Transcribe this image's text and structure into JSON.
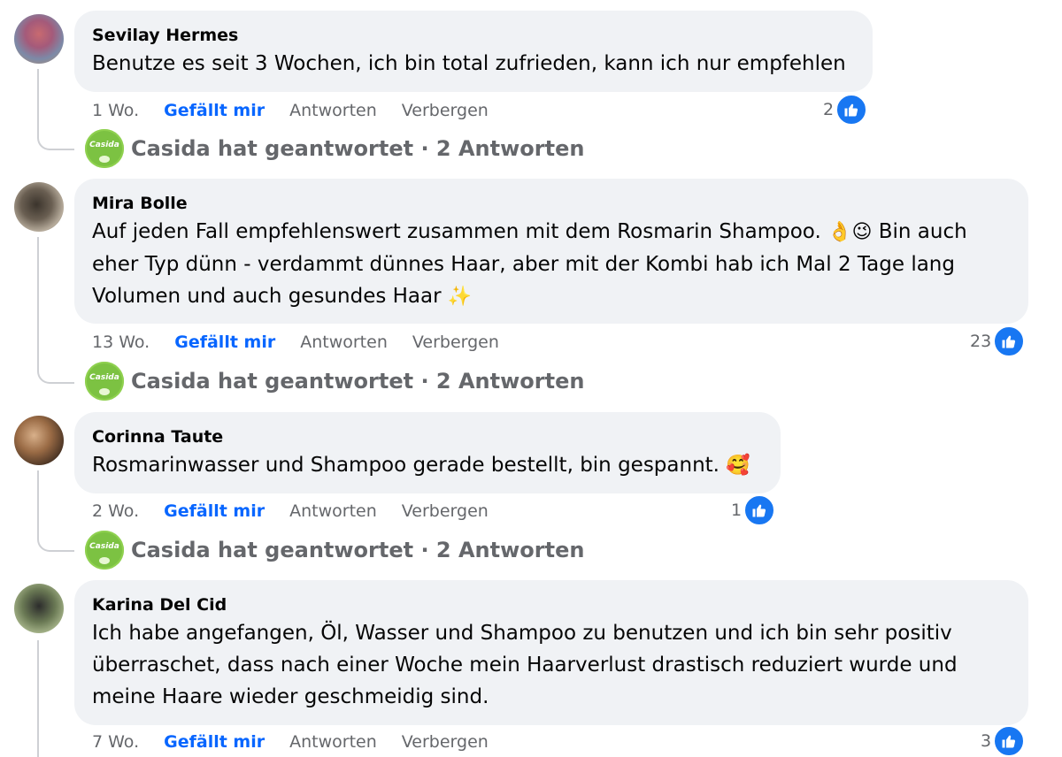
{
  "comments": [
    {
      "author": "Sevilay Hermes",
      "text": "Benutze es seit 3 Wochen, ich bin total zufrieden, kann ich nur empfehlen",
      "time": "1 Wo.",
      "like_label": "Gefällt mir",
      "reply_label": "Antworten",
      "hide_label": "Verbergen",
      "reaction_count": "2",
      "reply_summary": "Casida hat geantwortet · 2 Antworten"
    },
    {
      "author": "Mira Bolle",
      "text_part1": "Auf jeden Fall empfehlenswert zusammen mit dem Rosmarin Shampoo. ",
      "emoji1": "👌",
      "emoji2": "😉",
      "text_part2": " Bin auch eher Typ dünn - verdammt dünnes Haar, aber mit der Kombi hab ich Mal 2 Tage lang Volumen und auch gesundes Haar ",
      "emoji3": "✨",
      "time": "13 Wo.",
      "like_label": "Gefällt mir",
      "reply_label": "Antworten",
      "hide_label": "Verbergen",
      "reaction_count": "23",
      "reply_summary": "Casida hat geantwortet · 2 Antworten"
    },
    {
      "author": "Corinna Taute",
      "text": "Rosmarinwasser und Shampoo gerade bestellt, bin gespannt. ",
      "emoji1": "🥰",
      "time": "2 Wo.",
      "like_label": "Gefällt mir",
      "reply_label": "Antworten",
      "hide_label": "Verbergen",
      "reaction_count": "1",
      "reply_summary": "Casida hat geantwortet · 2 Antworten"
    },
    {
      "author": "Karina Del Cid",
      "text": "Ich habe angefangen, Öl, Wasser und Shampoo zu benutzen und ich bin sehr positiv überraschet, dass nach einer Woche mein Haarverlust drastisch reduziert wurde und meine Haare wieder geschmeidig sind.",
      "time": "7 Wo.",
      "like_label": "Gefällt mir",
      "reply_label": "Antworten",
      "hide_label": "Verbergen",
      "reaction_count": "3"
    }
  ],
  "page_avatar_text": "Casida",
  "colors": {
    "bubble": "#f0f2f5",
    "like_blue": "#0866ff",
    "badge_blue": "#1877f2",
    "secondary_text": "#65676b"
  },
  "icons": {
    "reaction": "like-thumb-icon",
    "page_avatar": "casida-logo"
  }
}
